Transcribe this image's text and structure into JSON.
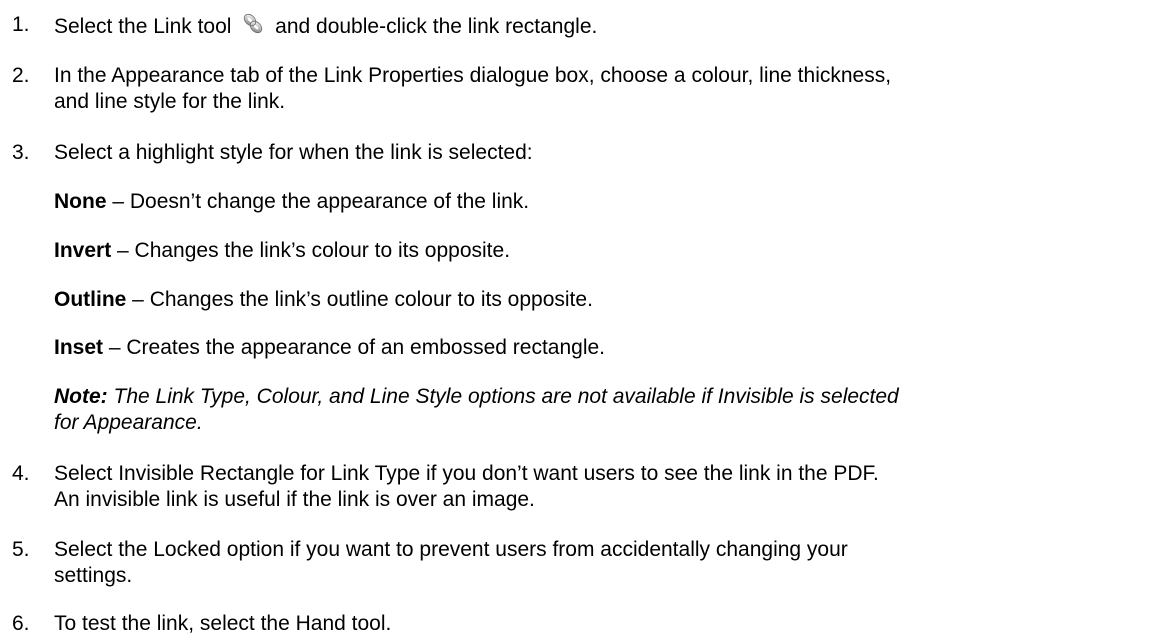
{
  "steps": [
    {
      "num": "1.",
      "before_icon": "Select the Link tool",
      "icon": "link-icon",
      "after_icon": "and double-click the link rectangle."
    },
    {
      "num": "2.",
      "line1": "In the Appearance tab of the Link Properties dialogue box, choose a colour, line thickness,",
      "line2": "and line style for the link."
    },
    {
      "num": "3.",
      "text": "Select a highlight style for when the link is selected:"
    },
    {
      "num": "4.",
      "line1": "Select Invisible Rectangle for Link Type if you don’t want users to see the link in the PDF.",
      "line2": "An invisible link is useful if the link is over an image."
    },
    {
      "num": "5.",
      "line1": "Select the Locked option if you want to prevent users from accidentally changing your",
      "line2": "settings."
    },
    {
      "num": "6.",
      "text": "To test the link, select the Hand tool."
    }
  ],
  "highlight_options": [
    {
      "term": "None",
      "desc": " – Doesn’t change the appearance of the link."
    },
    {
      "term": "Invert",
      "desc": " – Changes the link’s colour to its opposite."
    },
    {
      "term": "Outline",
      "desc": " – Changes the link’s outline colour to its opposite."
    },
    {
      "term": "Inset",
      "desc": " – Creates the appearance of an embossed rectangle."
    }
  ],
  "note": {
    "label": "Note:",
    "line1": " The Link Type, Colour, and Line Style options are not available if Invisible is selected",
    "line2": "for Appearance."
  }
}
